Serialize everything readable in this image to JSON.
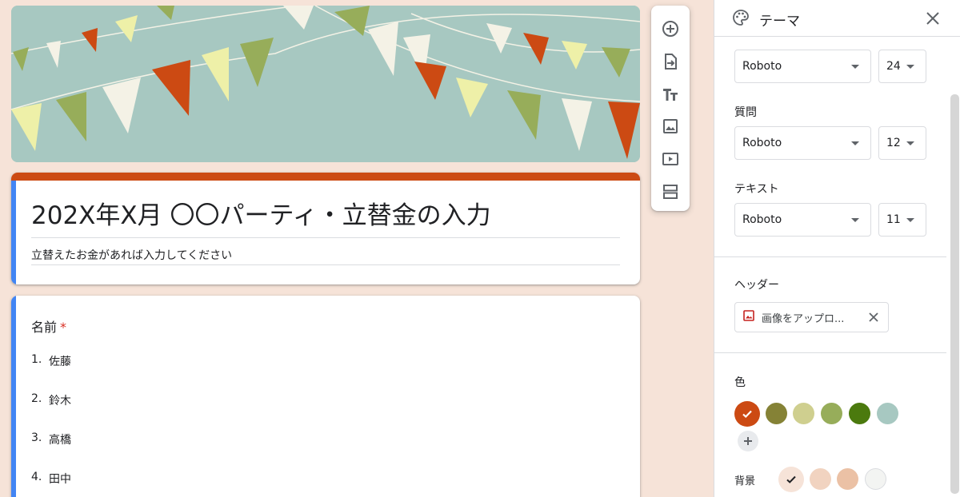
{
  "form": {
    "title": "202X年X月 〇〇パーティ・立替金の入力",
    "description": "立替えたお金があれば入力してください",
    "question": {
      "label": "名前",
      "required_mark": "*",
      "options": [
        {
          "num": "1.",
          "label": "佐藤"
        },
        {
          "num": "2.",
          "label": "鈴木"
        },
        {
          "num": "3.",
          "label": "高橋"
        },
        {
          "num": "4.",
          "label": "田中"
        }
      ]
    },
    "theme_color": "#cc4a13"
  },
  "toolbar": {
    "items": [
      "add-question-icon",
      "import-questions-icon",
      "add-title-icon",
      "add-image-icon",
      "add-video-icon",
      "add-section-icon"
    ]
  },
  "theme_panel": {
    "title": "テーマ",
    "header_font": {
      "font": "Roboto",
      "size": "24"
    },
    "question_section": {
      "label": "質問",
      "font": "Roboto",
      "size": "12"
    },
    "text_section": {
      "label": "テキスト",
      "font": "Roboto",
      "size": "11"
    },
    "header_section": {
      "label": "ヘッダー",
      "upload_label": "画像をアップロ..."
    },
    "color_section": {
      "label": "色",
      "colors": [
        "#cc4a13",
        "#858236",
        "#cfcf8f",
        "#97ad5a",
        "#4b7a0e",
        "#a7c8c1"
      ],
      "selected_index": 0
    },
    "background_section": {
      "label": "背景",
      "colors": [
        "#f6e3d8",
        "#f1d3c0",
        "#ebc1a5",
        "#f3f4f2"
      ],
      "selected_index": 0
    }
  }
}
